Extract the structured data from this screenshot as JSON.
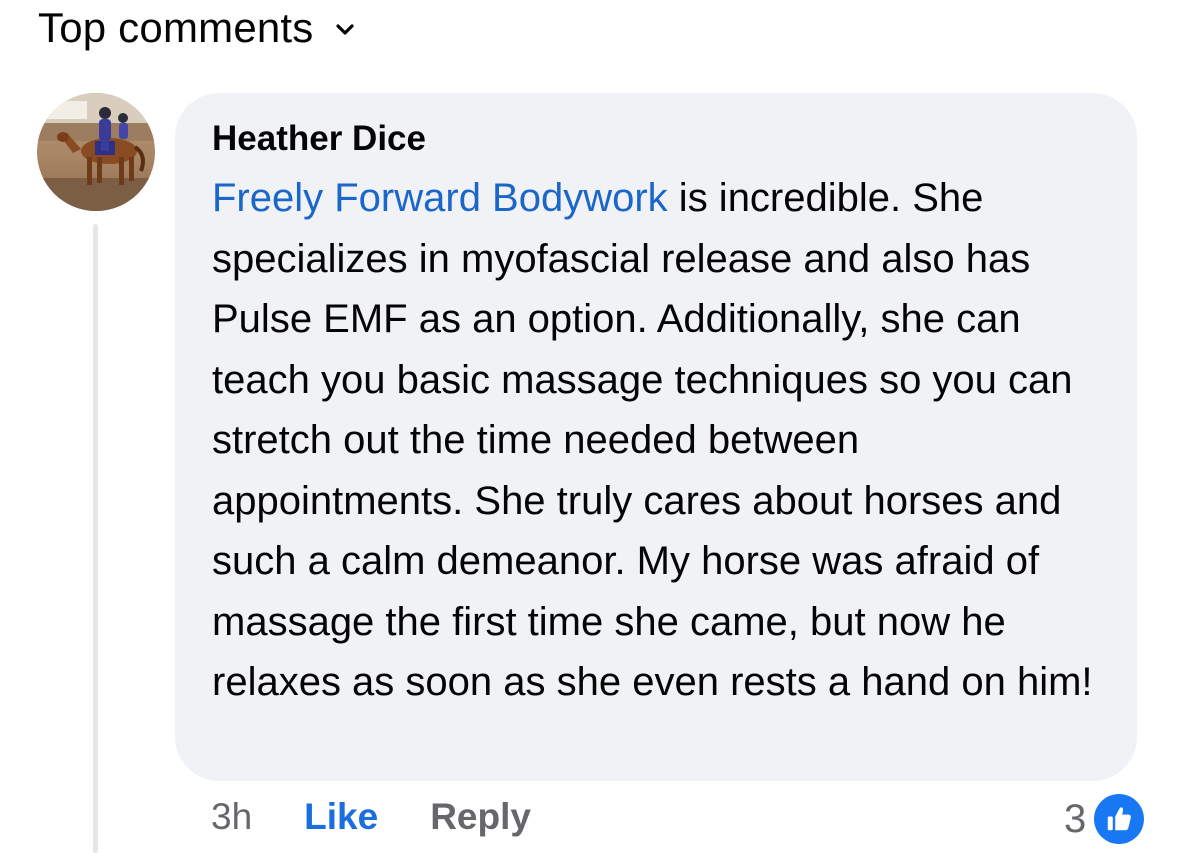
{
  "header": {
    "sort_label": "Top comments",
    "sort_icon": "chevron-down-icon"
  },
  "comment": {
    "author": "Heather Dice",
    "avatar_icon": "horse-rider-photo",
    "mention": "Freely Forward Bodywork",
    "body": " is incredible. She specializes in myofascial release and also has Pulse EMF as an option. Additionally, she can teach you basic massage techniques so you can stretch out the time needed between appointments. She truly cares about horses and such a calm demeanor. My horse was afraid of massage the first time she came, but now he relaxes as soon as she even rests a hand on him!",
    "timestamp": "3h",
    "like_label": "Like",
    "reply_label": "Reply",
    "reaction_count": "3",
    "reaction_icon": "thumbs-up-icon"
  },
  "colors": {
    "mention": "#1a66c9",
    "like_action": "#1a6ee0",
    "bubble": "#f0f2f5",
    "secondary_text": "#65676b",
    "like_badge": "#1877f2"
  }
}
